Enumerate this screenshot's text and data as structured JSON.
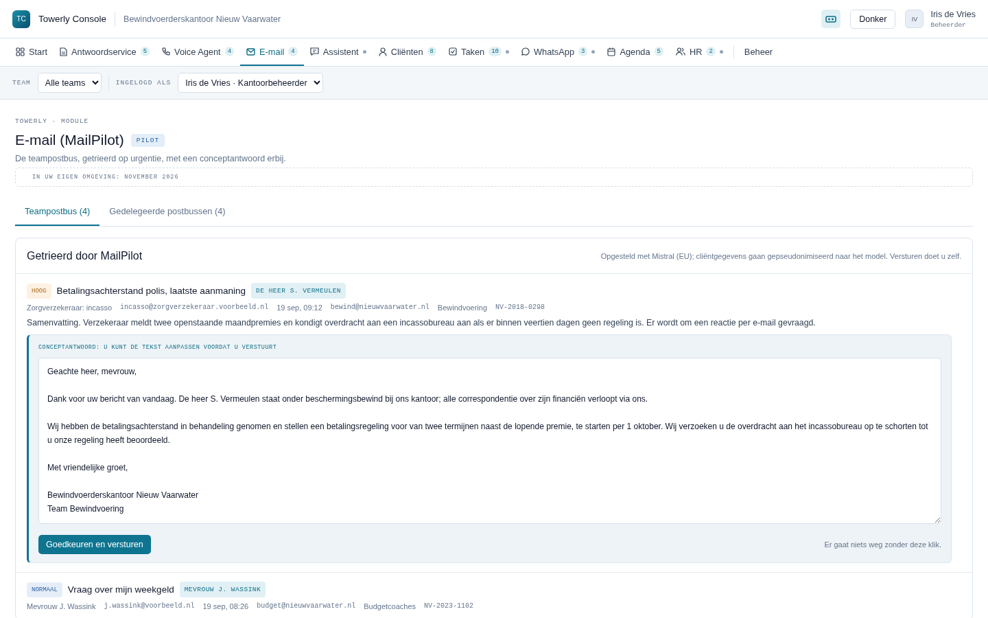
{
  "header": {
    "logo": "TC",
    "app_name": "Towerly Console",
    "organization": "Bewindvoerderskantoor Nieuw Vaarwater",
    "theme_button": "Donker",
    "user": {
      "initials": "IV",
      "name": "Iris de Vries",
      "role": "Beheerder"
    }
  },
  "nav": [
    {
      "label": "Start",
      "dot": false,
      "selected": false
    },
    {
      "label": "Antwoordservice",
      "badge": "5",
      "dot": false,
      "selected": false
    },
    {
      "label": "Voice Agent",
      "badge": "4",
      "dot": false,
      "selected": false
    },
    {
      "label": "E-mail",
      "badge": "4",
      "dot": false,
      "selected": true
    },
    {
      "label": "Assistent",
      "dot": true,
      "selected": false
    },
    {
      "label": "Cliënten",
      "badge": "8",
      "dot": false,
      "selected": false
    },
    {
      "label": "Taken",
      "badge": "10",
      "dot": true,
      "selected": false
    },
    {
      "label": "WhatsApp",
      "badge": "3",
      "dot": true,
      "selected": false
    },
    {
      "label": "Agenda",
      "badge": "5",
      "dot": false,
      "selected": false
    },
    {
      "label": "HR",
      "badge": "2",
      "dot": true,
      "selected": false
    },
    {
      "label": "Beheer",
      "dot": false,
      "selected": false
    }
  ],
  "filters": [
    {
      "label": "TEAM",
      "value": "Alle teams"
    },
    {
      "label": "INGELOGD ALS",
      "value": "Iris de Vries · Kantoorbeheerder"
    }
  ],
  "page": {
    "eyebrow": "TOWERLY · MODULE",
    "title": "E-mail (MailPilot)",
    "badge": "PILOT",
    "subtitle": "De teampostbus, getrieerd op urgentie, met een conceptantwoord erbij.",
    "notice": "IN UW EIGEN OMGEVING: NOVEMBER 2026"
  },
  "tabs": [
    {
      "label": "Teampostbus (4)",
      "selected": true
    },
    {
      "label": "Gedelegeerde postbussen (4)",
      "selected": false
    }
  ],
  "panel": {
    "title": "Getrieerd door MailPilot",
    "note": "Opgesteld met Mistral (EU); cliëntgegevens gaan gepseudonimiseerd naar het model. Versturen doet u zelf."
  },
  "emails": [
    {
      "priority": "HOOG",
      "kind": "high",
      "subject": "Betalingsachterstand polis, laatste aanmaning",
      "client": "DE HEER S. VERMEULEN",
      "meta": [
        "Zorgverzekeraar: incasso",
        "incasso@zorgverzekeraar.voorbeeld.nl",
        "19 sep, 09:12",
        "bewind@nieuwvaarwater.nl",
        "Bewindvoering",
        "NV-2018-0298"
      ],
      "summary": "Samenvatting. Verzekeraar meldt twee openstaande maandpremies en kondigt overdracht aan een incassobureau aan als er binnen veertien dagen geen regeling is. Er wordt om een reactie per e-mail gevraagd.",
      "draft": {
        "label": "CONCEPTANTWOORD: U KUNT DE TEKST AANPASSEN VOORDAT U VERSTUURT",
        "value": "Geachte heer, mevrouw,\n\nDank voor uw bericht van vandaag. De heer S. Vermeulen staat onder beschermingsbewind bij ons kantoor; alle correspondentie over zijn financiën verloopt via ons.\n\nWij hebben de betalingsachterstand in behandeling genomen en stellen een betalingsregeling voor van twee termijnen naast de lopende premie, te starten per 1 oktober. Wij verzoeken u de overdracht aan het incassobureau op te schorten tot u onze regeling heeft beoordeeld.\n\nMet vriendelijke groet,\n\nBewindvoerderskantoor Nieuw Vaarwater\nTeam Bewindvoering",
        "button": "Goedkeuren en versturen",
        "hint": "Er gaat niets weg zonder deze klik."
      }
    },
    {
      "priority": "NORMAAL",
      "kind": "normal",
      "subject": "Vraag over mijn weekgeld",
      "client": "MEVROUW J. WASSINK",
      "meta": [
        "Mevrouw J. Wassink",
        "j.wassink@voorbeeld.nl",
        "19 sep, 08:26",
        "budget@nieuwvaarwater.nl",
        "Budgetcoaches",
        "NV-2023-1102"
      ]
    }
  ]
}
